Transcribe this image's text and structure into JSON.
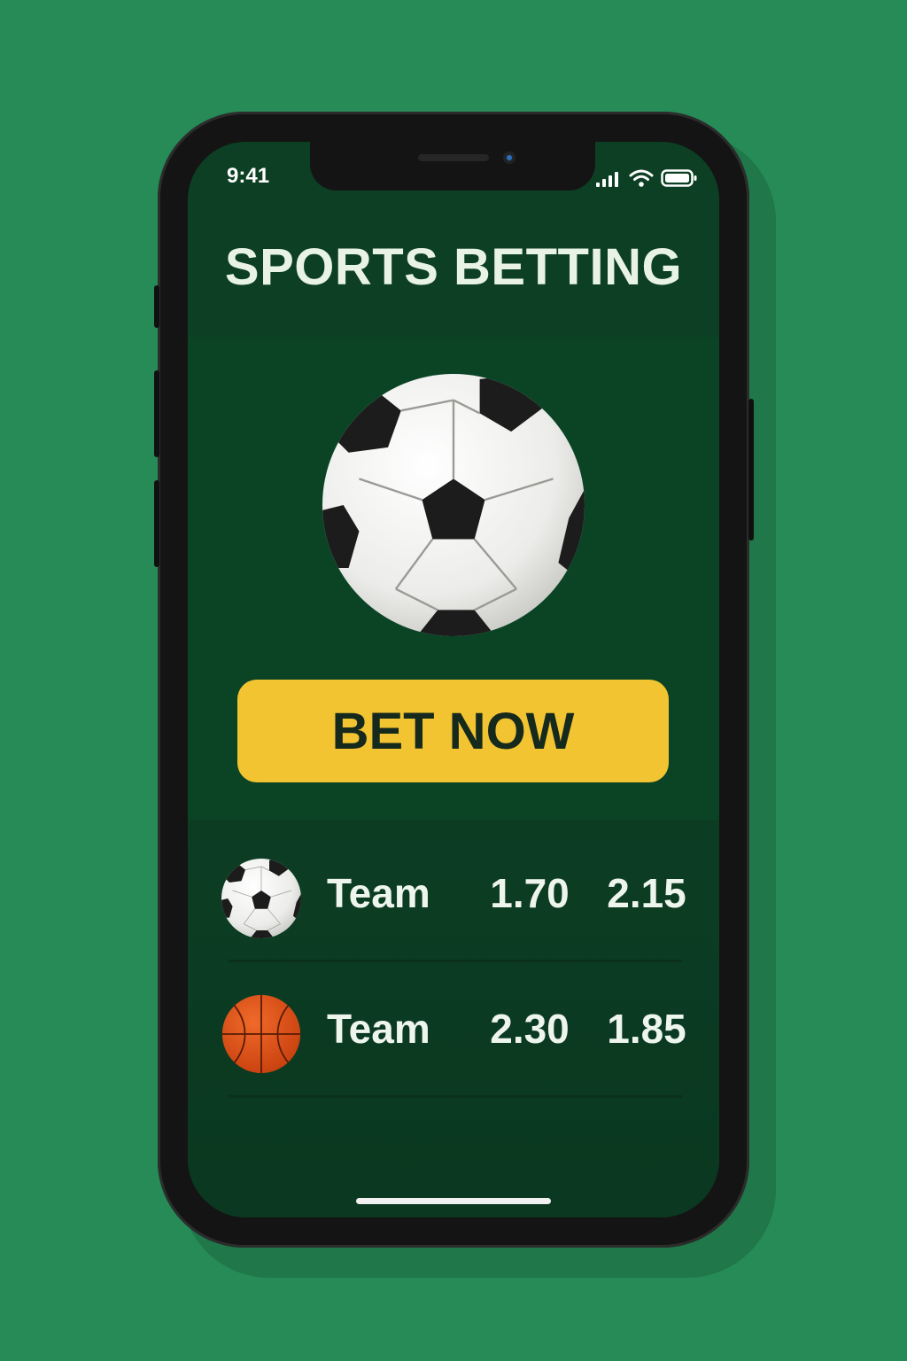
{
  "status_bar": {
    "time": "9:41",
    "icons": [
      "signal-icon",
      "wifi-icon",
      "battery-icon"
    ]
  },
  "header": {
    "title": "SPORTS BETTING"
  },
  "hero": {
    "icon": "soccer-ball-icon",
    "cta_label": "BET NOW"
  },
  "matches": [
    {
      "sport_icon": "soccer-ball-icon",
      "team": "Team",
      "odd_1": "1.70",
      "odd_2": "2.15"
    },
    {
      "sport_icon": "basketball-icon",
      "team": "Team",
      "odd_1": "2.30",
      "odd_2": "1.85"
    }
  ],
  "colors": {
    "background": "#268b57",
    "screen": "#0f4027",
    "header": "#0c3f23",
    "accent_button": "#f3c431",
    "text": "#e8f3e6"
  }
}
